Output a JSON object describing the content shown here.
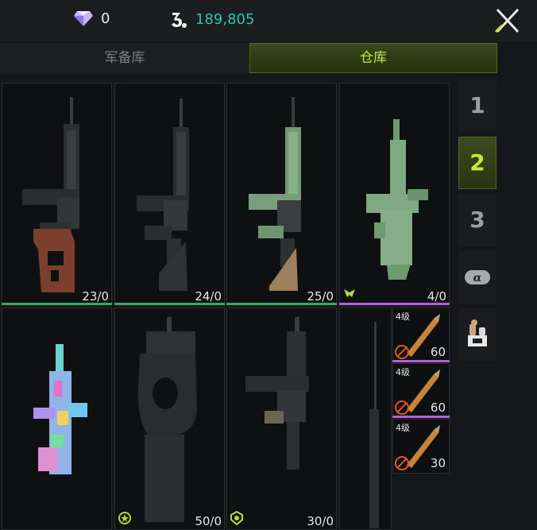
{
  "resources": {
    "gems": {
      "icon": "diamond-icon",
      "value": "0"
    },
    "coins": {
      "icon": "currency-icon",
      "value": "189,805"
    }
  },
  "tabs": [
    {
      "label": "军备库",
      "active": false
    },
    {
      "label": "仓库",
      "active": true
    }
  ],
  "weapons_row1": [
    {
      "name": "rifle-wood-stock",
      "count": "23/0",
      "bar_color": "#3fa46a"
    },
    {
      "name": "rifle-black",
      "count": "24/0",
      "bar_color": "#3fa46a"
    },
    {
      "name": "rifle-green-tan",
      "count": "25/0",
      "bar_color": "#3fa46a"
    },
    {
      "name": "bullpup-green",
      "count": "4/0",
      "bar_color": "#b060d8",
      "badge": "wing-emblem-icon"
    }
  ],
  "weapons_row2": [
    {
      "name": "rifle-holo-skin",
      "count": "",
      "bar_color": ""
    },
    {
      "name": "smg-p90",
      "count": "50/0",
      "bar_color": "",
      "badge": "star-emblem-icon"
    },
    {
      "name": "smg-black",
      "count": "30/0",
      "bar_color": "",
      "badge": "crest-emblem-icon"
    },
    {
      "name": "sniper-rifle",
      "count": "",
      "bar_color": ""
    }
  ],
  "ammo": [
    {
      "level": "4级",
      "count": "60"
    },
    {
      "level": "4级",
      "count": "60"
    },
    {
      "level": "4级",
      "count": "30"
    }
  ],
  "side_tabs": [
    {
      "label": "1",
      "active": false
    },
    {
      "label": "2",
      "active": true
    },
    {
      "label": "3",
      "active": false
    },
    {
      "label": "",
      "icon": "alpha-tag-icon"
    },
    {
      "label": "",
      "icon": "consumables-icon"
    }
  ],
  "colors": {
    "accent": "#c4e34a",
    "teal": "#2ec4b2",
    "common_bar": "#3fa46a",
    "rare_bar": "#b060d8"
  }
}
